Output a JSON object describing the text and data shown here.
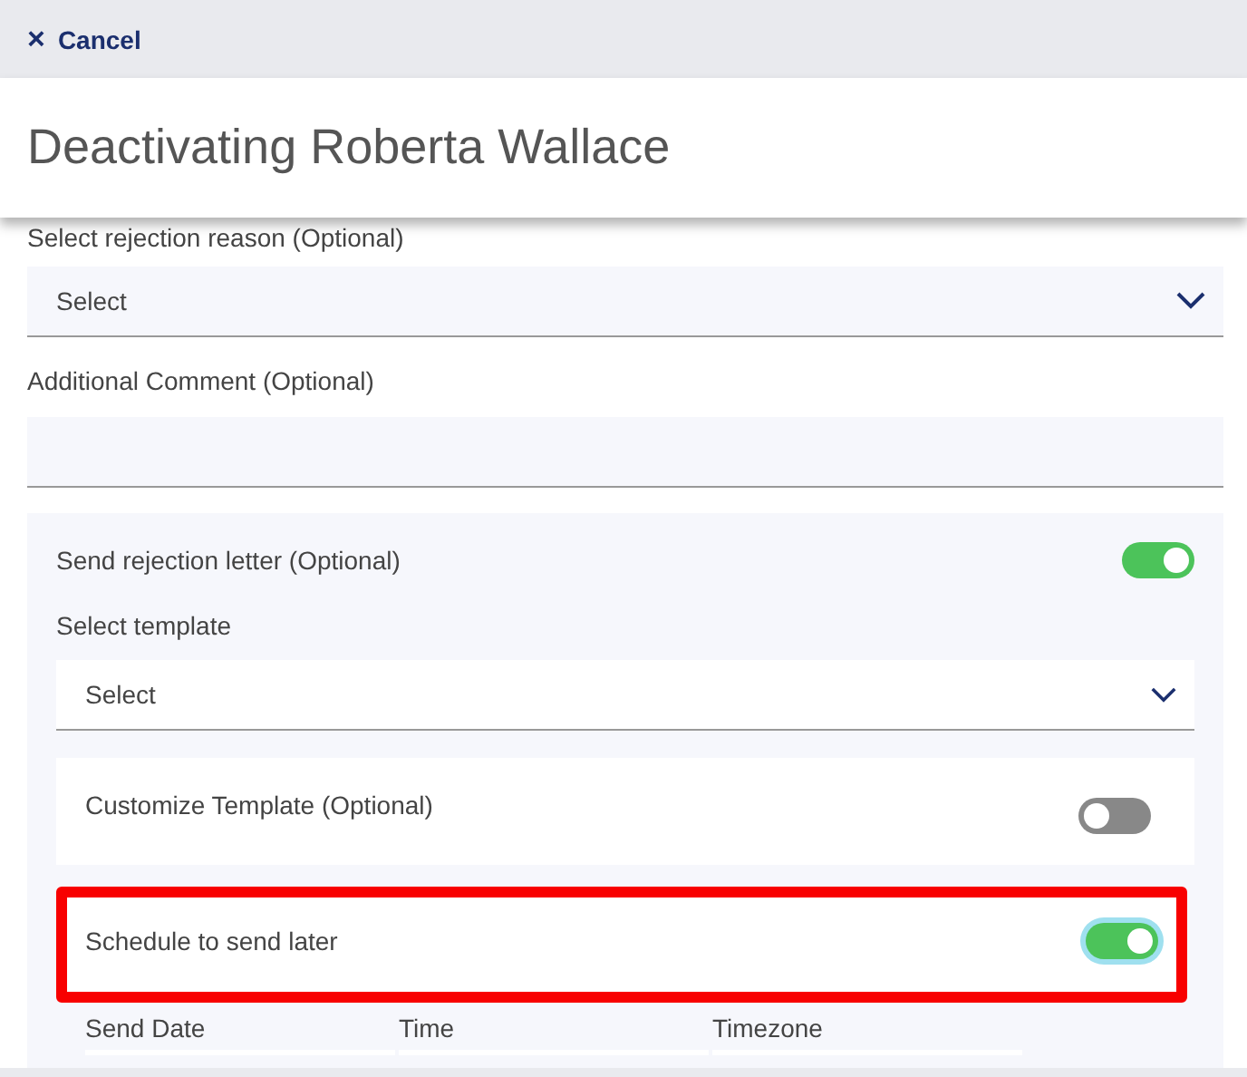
{
  "top_bar": {
    "cancel": {
      "icon": "×",
      "label": "Cancel"
    }
  },
  "header": {
    "title": "Deactivating Roberta Wallace"
  },
  "rejection_reason": {
    "label": "Select rejection reason (Optional)",
    "value": "Select"
  },
  "comment": {
    "label": "Additional Comment (Optional)"
  },
  "letter_panel": {
    "label": "Send rejection letter (Optional)",
    "on": true,
    "template": {
      "label": "Select template",
      "value": "Select"
    },
    "options": [
      {
        "label": "Customize Template (Optional)",
        "on": false,
        "focused": false,
        "highlighted": false
      },
      {
        "label": "Schedule to send later",
        "on": true,
        "focused": true,
        "highlighted": true
      }
    ],
    "schedule_fields": [
      {
        "label": "Send Date"
      },
      {
        "label": "Time"
      },
      {
        "label": "Timezone"
      }
    ]
  }
}
